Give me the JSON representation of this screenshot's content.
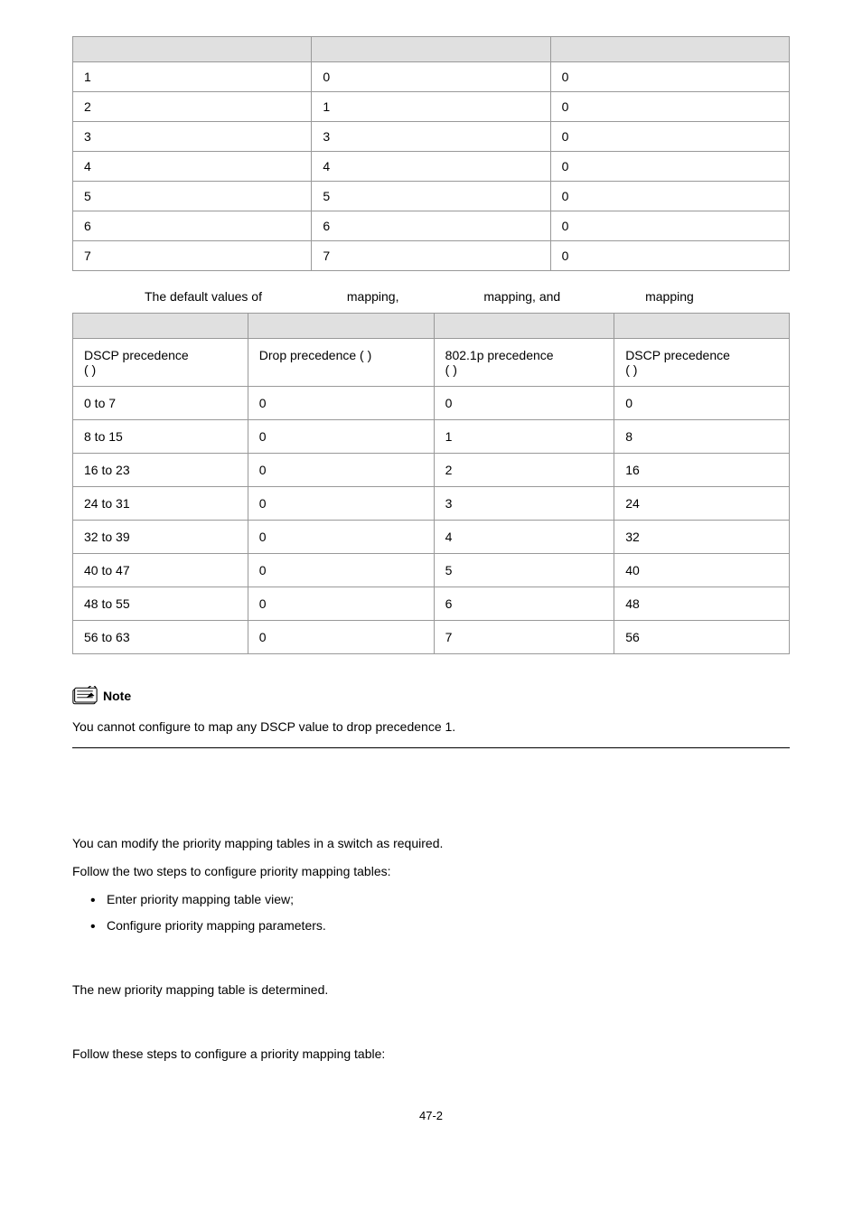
{
  "table1": {
    "headers": [
      "",
      "",
      ""
    ],
    "rows": [
      [
        "1",
        "0",
        "0"
      ],
      [
        "2",
        "1",
        "0"
      ],
      [
        "3",
        "3",
        "0"
      ],
      [
        "4",
        "4",
        "0"
      ],
      [
        "5",
        "5",
        "0"
      ],
      [
        "6",
        "6",
        "0"
      ],
      [
        "7",
        "7",
        "0"
      ]
    ]
  },
  "table2_caption": {
    "prefix": "The default values of",
    "part1": " mapping,",
    "part2": " mapping, and",
    "part3": " mapping"
  },
  "table2": {
    "headers": [
      "",
      "",
      "",
      ""
    ],
    "row1": {
      "c1": "DSCP precedence",
      "c1_paren": "(           )",
      "c2": "Drop precedence (      )",
      "c3": "802.1p precedence",
      "c3_paren": "(           )",
      "c4": "DSCP precedence",
      "c4_paren": "(           )"
    },
    "rows": [
      [
        "0 to 7",
        "0",
        "0",
        "0"
      ],
      [
        "8 to 15",
        "0",
        "1",
        "8"
      ],
      [
        "16 to 23",
        "0",
        "2",
        "16"
      ],
      [
        "24 to 31",
        "0",
        "3",
        "24"
      ],
      [
        "32 to 39",
        "0",
        "4",
        "32"
      ],
      [
        "40 to 47",
        "0",
        "5",
        "40"
      ],
      [
        "48 to 55",
        "0",
        "6",
        "48"
      ],
      [
        "56 to 63",
        "0",
        "7",
        "56"
      ]
    ]
  },
  "note": {
    "label": "Note",
    "text": "You cannot configure to map any DSCP value to drop precedence 1."
  },
  "section": {
    "body1": "You can modify the priority mapping tables in a switch as required.",
    "body2": "Follow the two steps to configure priority mapping tables:",
    "bullet1": "Enter priority mapping table view;",
    "bullet2": "Configure priority mapping parameters.",
    "sub_body1": "The new priority mapping table is determined.",
    "sub_body2": "Follow these steps to configure a priority mapping table:"
  },
  "page_number": "47-2"
}
